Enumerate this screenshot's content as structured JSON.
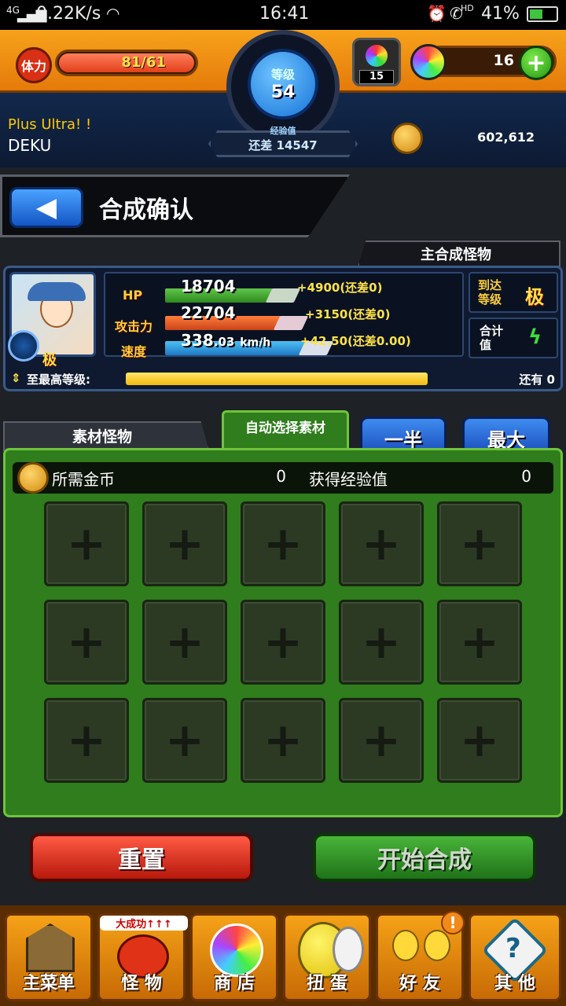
{
  "status_bar": {
    "signal": "4G",
    "speed": "0.22K/s",
    "time": "16:41",
    "hd": "HD",
    "battery": "41%"
  },
  "header": {
    "stamina_label": "体力",
    "stamina_value": "81/61",
    "level_label": "等级",
    "level_value": "54",
    "exp_label": "经验值",
    "exp_remaining": "还差 14547",
    "gacha_count": "15",
    "orb_count": "16",
    "coins": "602,612"
  },
  "profile": {
    "title": "Plus Ultra! !",
    "name": "DEKU"
  },
  "page": {
    "title": "合成确认",
    "main_monster_tab": "主合成怪物"
  },
  "monster": {
    "grade_badge": "极",
    "hp_label": "HP",
    "hp_value": "18704",
    "hp_bonus": "+4900(还差0)",
    "atk_label": "攻击力",
    "atk_value": "22704",
    "atk_bonus": "+3150(还差0)",
    "spd_label": "速度",
    "spd_value": "338",
    "spd_decimal": ".03",
    "spd_unit": "km/h",
    "spd_bonus": "+42.50(还差0.00)",
    "reach_level_label": "到达等级",
    "reach_level_value": "极",
    "luck_label": "合计值",
    "max_level_label": "至最高等级:",
    "max_level_remaining": "还有 0",
    "max_level_progress": 1.0
  },
  "material": {
    "tab_label": "素材怪物",
    "auto_select_label": "自动选择素材",
    "half_button": "一半",
    "max_button": "最大",
    "coins_needed_label": "所需金币",
    "coins_needed_value": "0",
    "exp_gain_label": "获得经验值",
    "exp_gain_value": "0",
    "slot_symbol": "+"
  },
  "actions": {
    "reset": "重置",
    "start": "开始合成"
  },
  "nav": {
    "items": [
      {
        "label": "主菜单"
      },
      {
        "label": "怪 物",
        "badge": "大成功↑↑↑"
      },
      {
        "label": "商 店"
      },
      {
        "label": "扭 蛋"
      },
      {
        "label": "好 友",
        "badge": "!"
      },
      {
        "label": "其 他"
      }
    ]
  }
}
